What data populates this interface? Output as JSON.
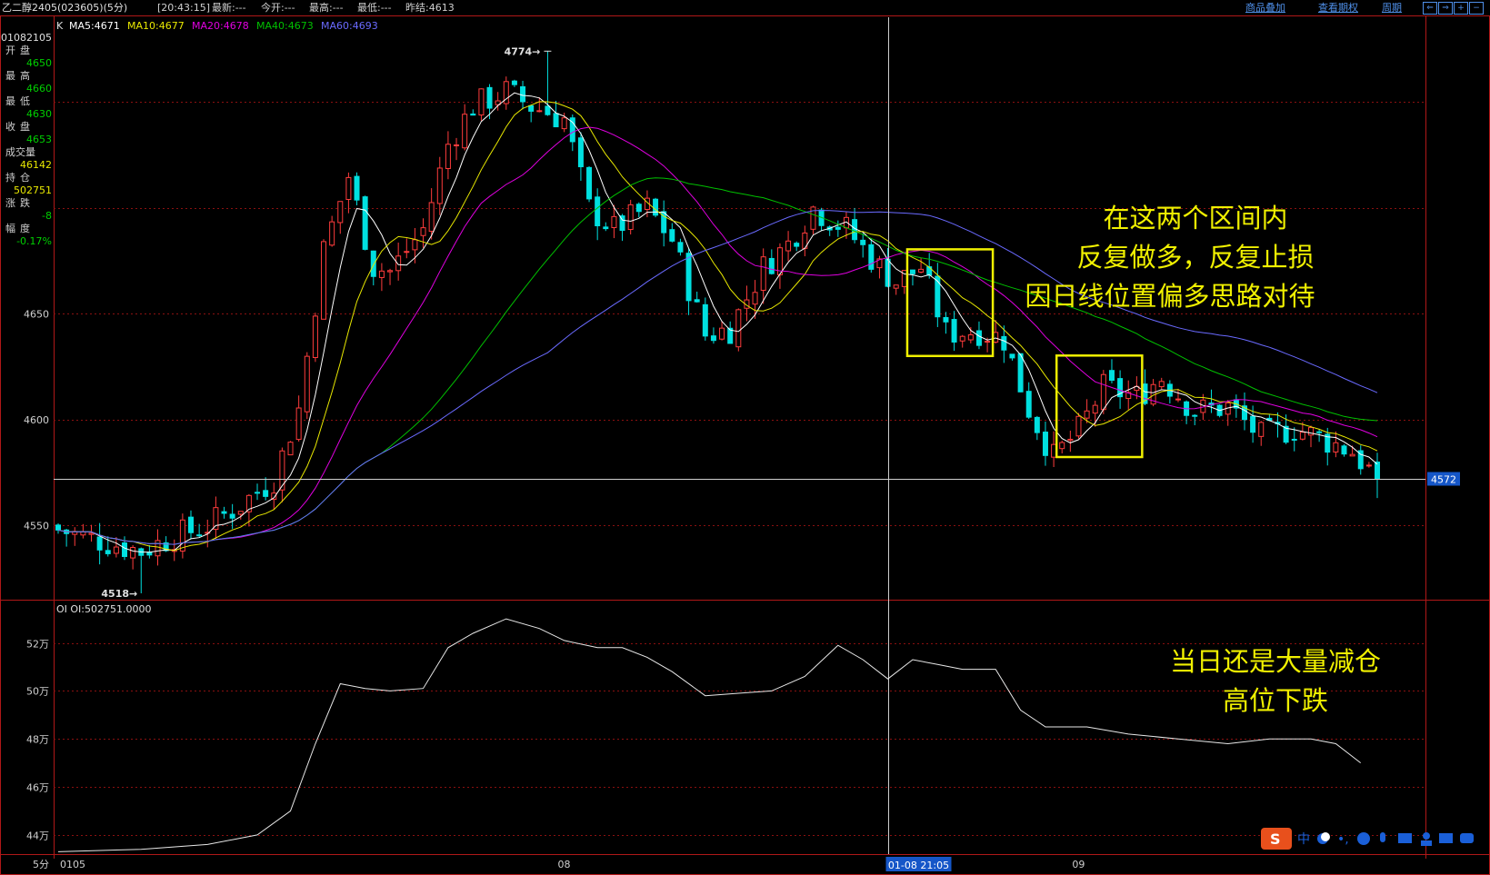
{
  "topbar": {
    "title": "乙二醇2405(023605)(5分)",
    "time": "[20:43:15]",
    "latest": "最新:---",
    "open_today": "今开:---",
    "high": "最高:---",
    "low": "最低:---",
    "prev_settle": "昨结:4613",
    "links": [
      "商品叠加",
      "查看期权",
      "周期"
    ],
    "nav_icons": [
      "arrow-left-icon",
      "arrow-right-icon",
      "zoom-in-icon",
      "zoom-out-icon"
    ]
  },
  "ma_legend": {
    "prefix": "K",
    "items": [
      {
        "label": "MA5:4671",
        "color": "#ffffff"
      },
      {
        "label": "MA10:4677",
        "color": "#e8e800"
      },
      {
        "label": "MA20:4678",
        "color": "#e000e0"
      },
      {
        "label": "MA40:4673",
        "color": "#00c000"
      },
      {
        "label": "MA60:4693",
        "color": "#6a6aff"
      }
    ]
  },
  "info_panel": {
    "date": "01082105",
    "rows": [
      {
        "label": "开盘",
        "value": "4650",
        "color": "#00d000"
      },
      {
        "label": "最高",
        "value": "4660",
        "color": "#00d000"
      },
      {
        "label": "最低",
        "value": "4630",
        "color": "#00d000"
      },
      {
        "label": "收盘",
        "value": "4653",
        "color": "#00d000"
      },
      {
        "label": "成交量",
        "value": "46142",
        "color": "#e8e800"
      },
      {
        "label": "持仓",
        "value": "502751",
        "color": "#e8e800"
      },
      {
        "label": "涨跌",
        "value": "-8",
        "color": "#00d000"
      },
      {
        "label": "幅度",
        "value": "-0.17%",
        "color": "#00d000"
      }
    ]
  },
  "annotations": {
    "range_note": [
      "在这两个区间内",
      "反复做多，反复止损",
      "因日线位置偏多思路对待"
    ],
    "oi_note": [
      "当日还是大量减仓",
      "高位下跌"
    ],
    "max_label": "4774",
    "min_label": "4518",
    "last_price": "4572",
    "cursor_time": "01-08 21:05",
    "period_label": "5分"
  },
  "oi_legend": "OI OI:502751.0000",
  "colors": {
    "up": "#ff3c3c",
    "down": "#00e0e0",
    "grid": "#8a1010",
    "frame": "#b01818",
    "text_yellow": "#f0f000"
  },
  "chart_data": [
    {
      "type": "candlestick",
      "title": "乙二醇2405(023605)(5分)",
      "ylim": [
        4515,
        4790
      ],
      "y_ticks": [
        4550,
        4600,
        4650
      ],
      "x_labels": [
        {
          "index": 0,
          "label": "0105"
        },
        {
          "index": 60,
          "label": "08"
        },
        {
          "index": 122,
          "label": "09"
        }
      ],
      "cursor_index": 100,
      "series": [
        {
          "name": "MA5",
          "value": 4671
        },
        {
          "name": "MA10",
          "value": 4677
        },
        {
          "name": "MA20",
          "value": 4678
        },
        {
          "name": "MA40",
          "value": 4673
        },
        {
          "name": "MA60",
          "value": 4693
        }
      ],
      "ohlc_waypoints": [
        {
          "i": 0,
          "c": 4548
        },
        {
          "i": 5,
          "c": 4543
        },
        {
          "i": 10,
          "c": 4538
        },
        {
          "i": 14,
          "c": 4545
        },
        {
          "i": 18,
          "c": 4550
        },
        {
          "i": 22,
          "c": 4560
        },
        {
          "i": 26,
          "c": 4572
        },
        {
          "i": 29,
          "c": 4605
        },
        {
          "i": 32,
          "c": 4680
        },
        {
          "i": 35,
          "c": 4715
        },
        {
          "i": 38,
          "c": 4672
        },
        {
          "i": 40,
          "c": 4670
        },
        {
          "i": 44,
          "c": 4690
        },
        {
          "i": 47,
          "c": 4730
        },
        {
          "i": 50,
          "c": 4748
        },
        {
          "i": 54,
          "c": 4755
        },
        {
          "i": 57,
          "c": 4748
        },
        {
          "i": 61,
          "c": 4742
        },
        {
          "i": 64,
          "c": 4700
        },
        {
          "i": 67,
          "c": 4690
        },
        {
          "i": 71,
          "c": 4700
        },
        {
          "i": 74,
          "c": 4685
        },
        {
          "i": 78,
          "c": 4640
        },
        {
          "i": 81,
          "c": 4643
        },
        {
          "i": 85,
          "c": 4672
        },
        {
          "i": 88,
          "c": 4683
        },
        {
          "i": 91,
          "c": 4700
        },
        {
          "i": 95,
          "c": 4690
        },
        {
          "i": 99,
          "c": 4672
        },
        {
          "i": 101,
          "c": 4665
        },
        {
          "i": 104,
          "c": 4672
        },
        {
          "i": 107,
          "c": 4641
        },
        {
          "i": 111,
          "c": 4642
        },
        {
          "i": 114,
          "c": 4638
        },
        {
          "i": 117,
          "c": 4605
        },
        {
          "i": 120,
          "c": 4582
        },
        {
          "i": 123,
          "c": 4595
        },
        {
          "i": 126,
          "c": 4615
        },
        {
          "i": 130,
          "c": 4611
        },
        {
          "i": 133,
          "c": 4620
        },
        {
          "i": 137,
          "c": 4604
        },
        {
          "i": 141,
          "c": 4606
        },
        {
          "i": 145,
          "c": 4592
        },
        {
          "i": 149,
          "c": 4596
        },
        {
          "i": 153,
          "c": 4590
        },
        {
          "i": 156,
          "c": 4585
        },
        {
          "i": 159,
          "c": 4572
        }
      ],
      "highlight_boxes": [
        {
          "from": 103,
          "to": 112
        },
        {
          "from": 121,
          "to": 130
        }
      ]
    },
    {
      "type": "line",
      "title": "OI OI:502751.0000",
      "ylim": [
        432000,
        538000
      ],
      "y_ticks": [
        440000,
        460000,
        480000,
        500000,
        520000
      ],
      "y_tick_labels": [
        "44万",
        "46万",
        "48万",
        "50万",
        "52万"
      ],
      "series": [
        {
          "name": "OI",
          "points": [
            {
              "i": 0,
              "v": 433000
            },
            {
              "i": 10,
              "v": 434000
            },
            {
              "i": 18,
              "v": 436000
            },
            {
              "i": 24,
              "v": 440000
            },
            {
              "i": 28,
              "v": 450000
            },
            {
              "i": 31,
              "v": 478000
            },
            {
              "i": 34,
              "v": 503000
            },
            {
              "i": 37,
              "v": 501000
            },
            {
              "i": 40,
              "v": 500000
            },
            {
              "i": 44,
              "v": 501000
            },
            {
              "i": 47,
              "v": 518000
            },
            {
              "i": 50,
              "v": 524000
            },
            {
              "i": 54,
              "v": 530000
            },
            {
              "i": 58,
              "v": 526000
            },
            {
              "i": 61,
              "v": 521000
            },
            {
              "i": 65,
              "v": 518000
            },
            {
              "i": 68,
              "v": 518000
            },
            {
              "i": 71,
              "v": 514000
            },
            {
              "i": 74,
              "v": 508000
            },
            {
              "i": 78,
              "v": 498000
            },
            {
              "i": 82,
              "v": 499000
            },
            {
              "i": 86,
              "v": 500000
            },
            {
              "i": 90,
              "v": 506000
            },
            {
              "i": 94,
              "v": 519000
            },
            {
              "i": 97,
              "v": 513000
            },
            {
              "i": 100,
              "v": 505000
            },
            {
              "i": 103,
              "v": 513000
            },
            {
              "i": 106,
              "v": 511000
            },
            {
              "i": 109,
              "v": 509000
            },
            {
              "i": 113,
              "v": 509000
            },
            {
              "i": 116,
              "v": 492000
            },
            {
              "i": 119,
              "v": 485000
            },
            {
              "i": 124,
              "v": 485000
            },
            {
              "i": 129,
              "v": 482000
            },
            {
              "i": 135,
              "v": 480000
            },
            {
              "i": 141,
              "v": 478000
            },
            {
              "i": 146,
              "v": 480000
            },
            {
              "i": 151,
              "v": 480000
            },
            {
              "i": 154,
              "v": 478000
            },
            {
              "i": 157,
              "v": 470000
            }
          ]
        }
      ]
    }
  ]
}
